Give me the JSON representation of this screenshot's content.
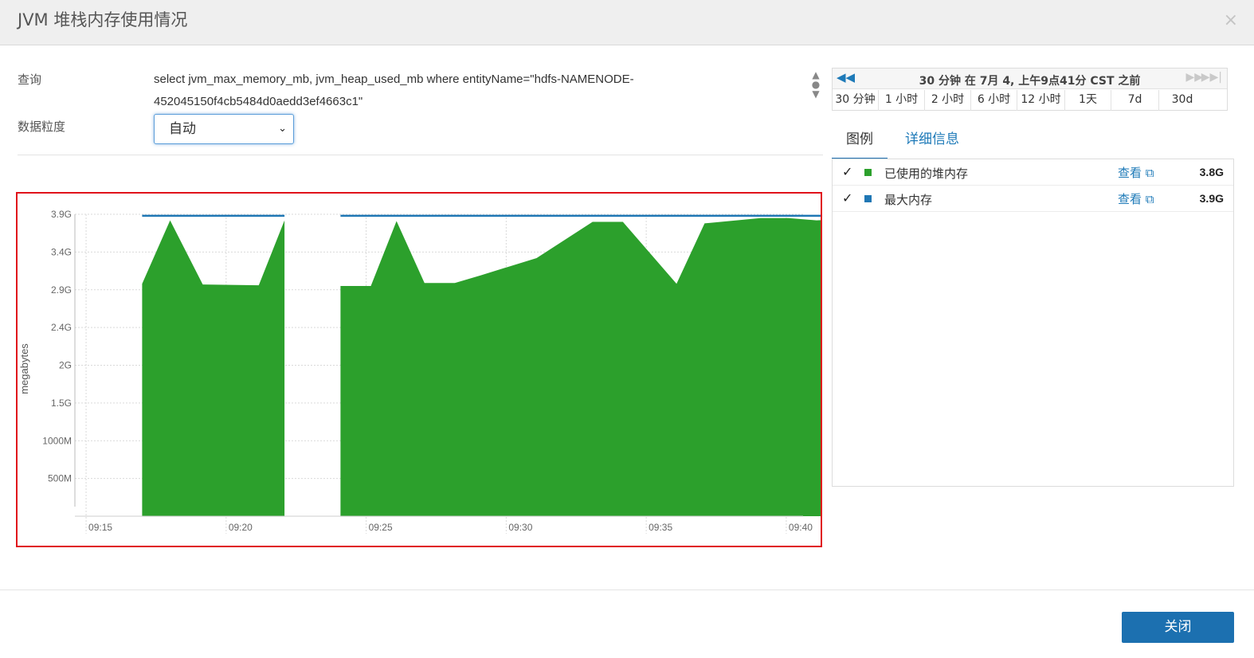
{
  "dialog": {
    "title": "JVM 堆栈内存使用情况",
    "close_glyph": "×"
  },
  "query": {
    "label": "查询",
    "text": "select jvm_max_memory_mb, jvm_heap_used_mb where entityName=\"hdfs-NAMENODE-452045150f4cb5484d0aedd3ef4663c1\""
  },
  "granularity": {
    "label": "数据粒度",
    "selected": "自动"
  },
  "time_nav": {
    "title": "30 分钟 在 7月 4, 上午9点41分 CST 之前",
    "prev_icon": "rewind-icon",
    "next_icon": "forward-icon",
    "last_icon": "fast-forward-end-icon",
    "ranges": [
      "30 分钟",
      "1 小时",
      "2 小时",
      "6 小时",
      "12 小时",
      "1天",
      "7d",
      "30d"
    ]
  },
  "tabs": {
    "legend": "图例",
    "details": "详细信息"
  },
  "legend": [
    {
      "check": "✓",
      "name": "已使用的堆内存",
      "view": "查看",
      "value": "3.8G",
      "color": "#2ca02c"
    },
    {
      "check": "✓",
      "name": "最大内存",
      "view": "查看",
      "value": "3.9G",
      "color": "#1f77b4"
    }
  ],
  "footer": {
    "close_label": "关闭"
  },
  "chart_data": {
    "type": "area",
    "ylabel": "megabytes",
    "y_ticks": [
      {
        "label": "500M",
        "value": 500
      },
      {
        "label": "1000M",
        "value": 1000
      },
      {
        "label": "1.5G",
        "value": 1500
      },
      {
        "label": "2G",
        "value": 2000
      },
      {
        "label": "2.4G",
        "value": 2500
      },
      {
        "label": "2.9G",
        "value": 3000
      },
      {
        "label": "3.4G",
        "value": 3500
      },
      {
        "label": "3.9G",
        "value": 4000
      }
    ],
    "ylim": [
      0,
      4000
    ],
    "x_ticks": [
      "09:15",
      "09:20",
      "09:25",
      "09:30",
      "09:35",
      "09:40"
    ],
    "x_range_minutes": [
      554.6,
      580.6
    ],
    "grid": true,
    "colors": {
      "used": "#2ca02c",
      "max": "#1f77b4"
    },
    "series": [
      {
        "name": "已使用的堆内存",
        "segments": [
          [
            {
              "x": "09:17:00",
              "y": 3080
            },
            {
              "x": "09:18:00",
              "y": 3920
            },
            {
              "x": "09:19:10",
              "y": 3070
            },
            {
              "x": "09:21:10",
              "y": 3060
            },
            {
              "x": "09:22:05",
              "y": 3920
            }
          ],
          [
            {
              "x": "09:24:05",
              "y": 3050
            },
            {
              "x": "09:25:10",
              "y": 3050
            },
            {
              "x": "09:26:05",
              "y": 3910
            },
            {
              "x": "09:27:05",
              "y": 3090
            },
            {
              "x": "09:28:10",
              "y": 3090
            },
            {
              "x": "09:29:05",
              "y": 3190
            },
            {
              "x": "09:31:05",
              "y": 3420
            },
            {
              "x": "09:33:05",
              "y": 3900
            },
            {
              "x": "09:34:10",
              "y": 3900
            },
            {
              "x": "09:36:05",
              "y": 3080
            },
            {
              "x": "09:37:05",
              "y": 3880
            },
            {
              "x": "09:39:05",
              "y": 3950
            },
            {
              "x": "09:40:05",
              "y": 3950
            },
            {
              "x": "09:41:05",
              "y": 3920
            },
            {
              "x": "09:42:05",
              "y": 3940
            },
            {
              "x": "09:43:10",
              "y": 3940
            },
            {
              "x": "09:44:05",
              "y": 3030
            },
            {
              "x": "09:44:40",
              "y": 3840
            }
          ]
        ]
      },
      {
        "name": "最大内存",
        "segments": [
          [
            {
              "x": "09:17:00",
              "y": 3980
            },
            {
              "x": "09:22:05",
              "y": 3980
            }
          ],
          [
            {
              "x": "09:24:05",
              "y": 3980
            },
            {
              "x": "09:44:40",
              "y": 3980
            }
          ]
        ]
      }
    ]
  }
}
